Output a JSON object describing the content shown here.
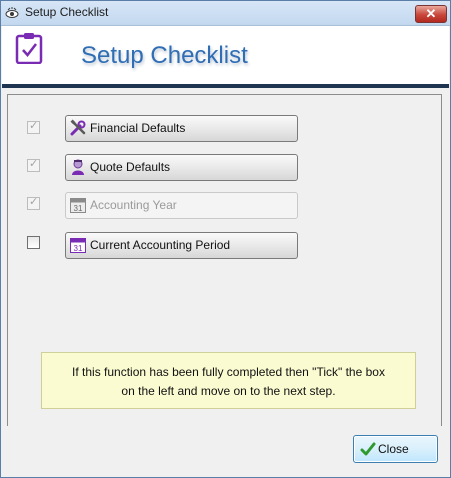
{
  "window": {
    "title": "Setup Checklist"
  },
  "header": {
    "title": "Setup Checklist"
  },
  "tasks": [
    {
      "label": "Financial Defaults",
      "checked": true,
      "checkbox_enabled": false,
      "button_enabled": true,
      "icon": "tools-icon"
    },
    {
      "label": "Quote Defaults",
      "checked": true,
      "checkbox_enabled": false,
      "button_enabled": true,
      "icon": "person-icon"
    },
    {
      "label": "Accounting Year",
      "checked": true,
      "checkbox_enabled": false,
      "button_enabled": false,
      "icon": "calendar-icon"
    },
    {
      "label": "Current Accounting Period",
      "checked": false,
      "checkbox_enabled": true,
      "button_enabled": true,
      "icon": "calendar-icon"
    }
  ],
  "info": {
    "line1": "If this function has been fully completed then \"Tick\" the box",
    "line2": "on the left and move on to the next step."
  },
  "footer": {
    "close_label": "Close"
  },
  "colors": {
    "title_blue": "#2f6db5",
    "header_rule": "#1f3450",
    "info_bg": "#fbfbd2",
    "icon_purple": "#7a2bb3"
  }
}
